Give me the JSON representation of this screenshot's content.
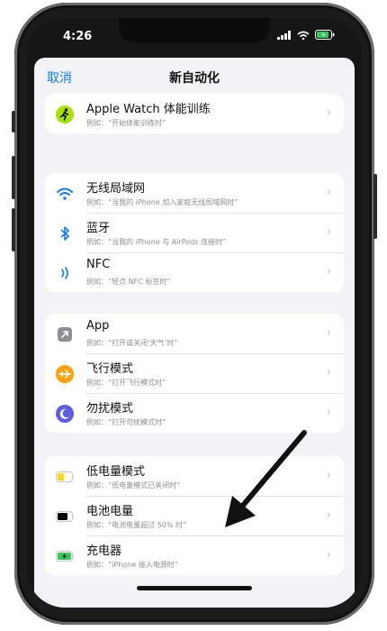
{
  "status_bar": {
    "time": "4:26"
  },
  "nav": {
    "cancel": "取消",
    "title": "新自动化"
  },
  "groups": [
    {
      "rows": [
        {
          "label": "Apple Watch 体能训练",
          "sub": "例如：“开始体能训练时”",
          "icon": "workout-icon"
        }
      ]
    },
    {
      "rows": [
        {
          "label": "无线局域网",
          "sub": "例如：“当我的 iPhone 加入家庭无线局域网时”",
          "icon": "wifi-icon"
        },
        {
          "label": "蓝牙",
          "sub": "例如：“当我的 iPhone 与 AirPods 连接时”",
          "icon": "bluetooth-icon"
        },
        {
          "label": "NFC",
          "sub": "例如：“轻点 NFC 标签时”",
          "icon": "nfc-icon"
        }
      ]
    },
    {
      "rows": [
        {
          "label": "App",
          "sub": "例如：“打开或关闭‘天气’时”",
          "icon": "app-icon"
        },
        {
          "label": "飞行模式",
          "sub": "例如：“打开飞行模式时”",
          "icon": "airplane-mode-icon"
        },
        {
          "label": "勿扰模式",
          "sub": "例如：“打开勿扰模式时”",
          "icon": "do-not-disturb-icon"
        }
      ]
    },
    {
      "rows": [
        {
          "label": "低电量模式",
          "sub": "例如：“低电量模式已关闭时”",
          "icon": "low-power-battery-icon"
        },
        {
          "label": "电池电量",
          "sub": "例如：“电池电量超过 50% 时”",
          "icon": "battery-level-icon"
        },
        {
          "label": "充电器",
          "sub": "例如：“iPhone 接入电源时”",
          "icon": "charger-icon"
        }
      ]
    }
  ],
  "chevron": "›",
  "colors": {
    "accent": "#0a7cff",
    "workout": "#a4e400",
    "airplane": "#ff9f0a",
    "dnd": "#5e5ce6",
    "low_power": "#ffd60a",
    "charging": "#34c759"
  }
}
